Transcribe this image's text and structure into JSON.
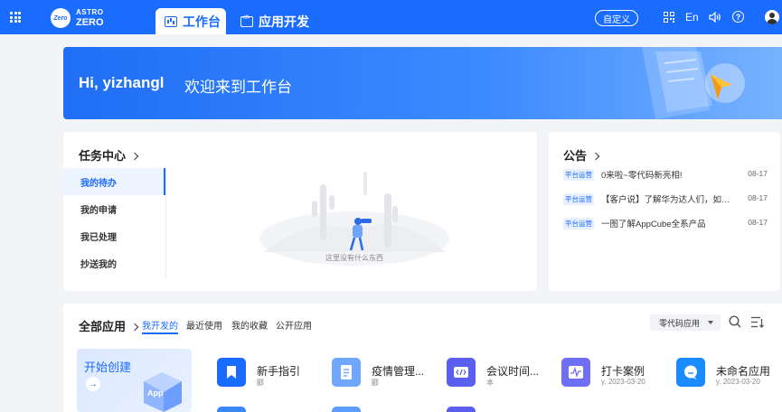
{
  "header": {
    "logo": {
      "badge": "Zero",
      "line1": "ASTRO",
      "line2": "ZERO"
    },
    "tabs": [
      {
        "label": "工作台",
        "active": true
      },
      {
        "label": "应用开发",
        "active": false
      }
    ],
    "customize_label": "自定义",
    "language": "En"
  },
  "banner": {
    "greeting": "Hi, yizhangl",
    "welcome": "欢迎来到工作台"
  },
  "task_center": {
    "title": "任务中心",
    "items": [
      {
        "label": "我的待办",
        "active": true
      },
      {
        "label": "我的申请",
        "active": false
      },
      {
        "label": "我已处理",
        "active": false
      },
      {
        "label": "抄送我的",
        "active": false
      }
    ],
    "empty_text": "这里没有什么东西"
  },
  "notices": {
    "title": "公告",
    "items": [
      {
        "tag": "平台运营",
        "text": "0来啦~零代码新亮相!",
        "date": "08-17"
      },
      {
        "tag": "平台运营",
        "text": "【客户说】了解华为达人们，如…",
        "date": "08-17"
      },
      {
        "tag": "平台运营",
        "text": "一图了解AppCube全系产品",
        "date": "08-17"
      }
    ]
  },
  "apps": {
    "title": "全部应用",
    "tabs": [
      {
        "label": "我开发的",
        "active": true
      },
      {
        "label": "最近使用",
        "active": false
      },
      {
        "label": "我的收藏",
        "active": false
      },
      {
        "label": "公开应用",
        "active": false
      }
    ],
    "filter_value": "零代码应用",
    "create": {
      "label": "开始创建",
      "art_text": "App"
    },
    "items": [
      {
        "name": "新手指引",
        "sub": "郾",
        "color": "#1a6cff",
        "icon": "bookmark-icon"
      },
      {
        "name": "疫情管理...",
        "sub": "郾",
        "color": "#6fa6ff",
        "icon": "document-icon"
      },
      {
        "name": "会议时间...",
        "sub": "本",
        "color": "#5b5ff0",
        "icon": "code-icon"
      },
      {
        "name": "打卡案例",
        "sub": "y.  2023-03-20",
        "color": "#6f6ff5",
        "icon": "pulse-icon"
      },
      {
        "name": "未命名应用",
        "sub": "y.  2023-03-20",
        "color": "#1a8cff",
        "icon": "chat-icon"
      }
    ],
    "partial_icon_colors": [
      "#3a86ff",
      "#5b9dff",
      "#5b5ff0"
    ]
  },
  "colors": {
    "brand": "#1a6cff",
    "page_bg": "#f2f4f8"
  }
}
